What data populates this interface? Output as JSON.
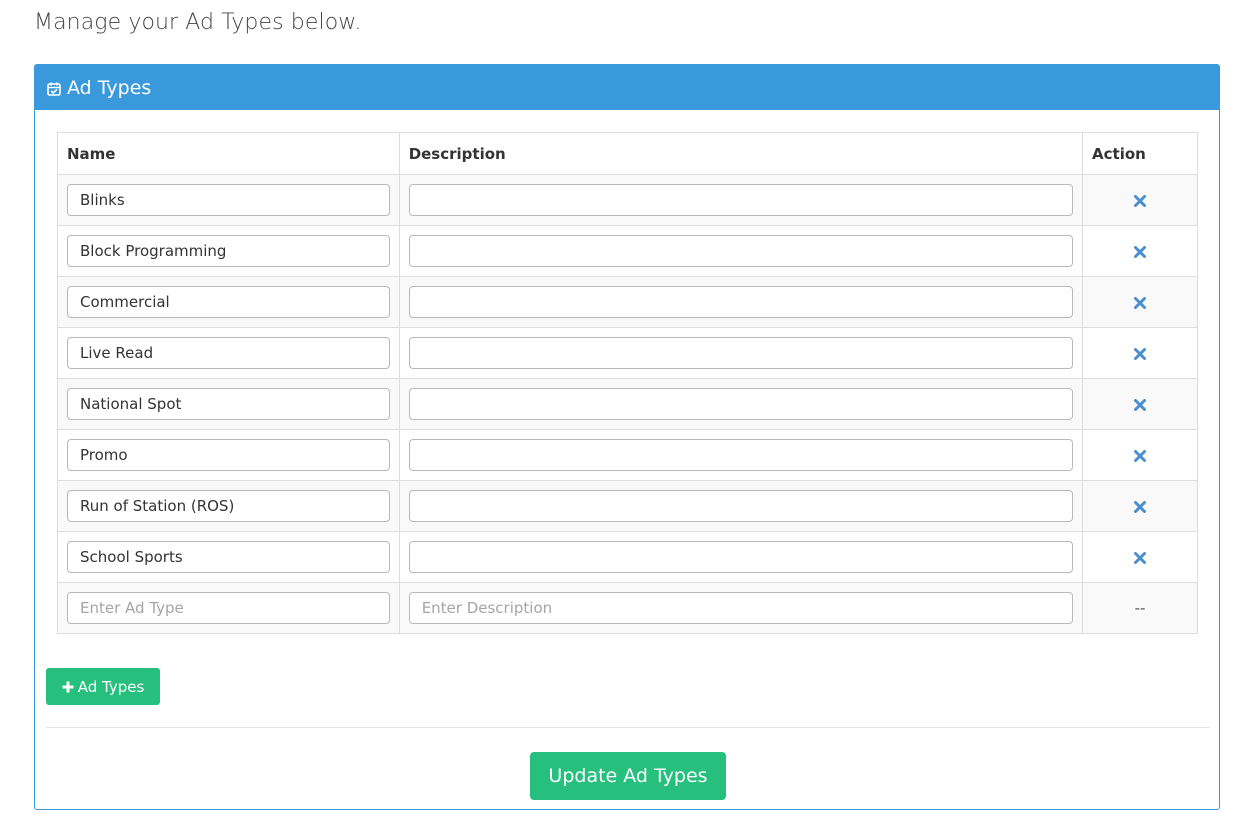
{
  "intro_text": "Manage your Ad Types below.",
  "panel": {
    "title": "Ad Types",
    "header_icon": "calendar-check-icon",
    "header_color": "#3a99db"
  },
  "table": {
    "columns": [
      "Name",
      "Description",
      "Action"
    ],
    "rows": [
      {
        "name": "Blinks",
        "description": ""
      },
      {
        "name": "Block Programming",
        "description": ""
      },
      {
        "name": "Commercial",
        "description": ""
      },
      {
        "name": "Live Read",
        "description": ""
      },
      {
        "name": "National Spot",
        "description": ""
      },
      {
        "name": "Promo",
        "description": ""
      },
      {
        "name": "Run of Station (ROS)",
        "description": ""
      },
      {
        "name": "School Sports",
        "description": ""
      }
    ],
    "delete_icon": "times-icon",
    "new_row": {
      "name_placeholder": "Enter Ad Type",
      "description_placeholder": "Enter Description",
      "action_text": "--"
    }
  },
  "buttons": {
    "add_label": "Ad Types",
    "add_icon": "plus-icon",
    "update_label": "Update Ad Types",
    "accent_color": "#26bf7e"
  }
}
